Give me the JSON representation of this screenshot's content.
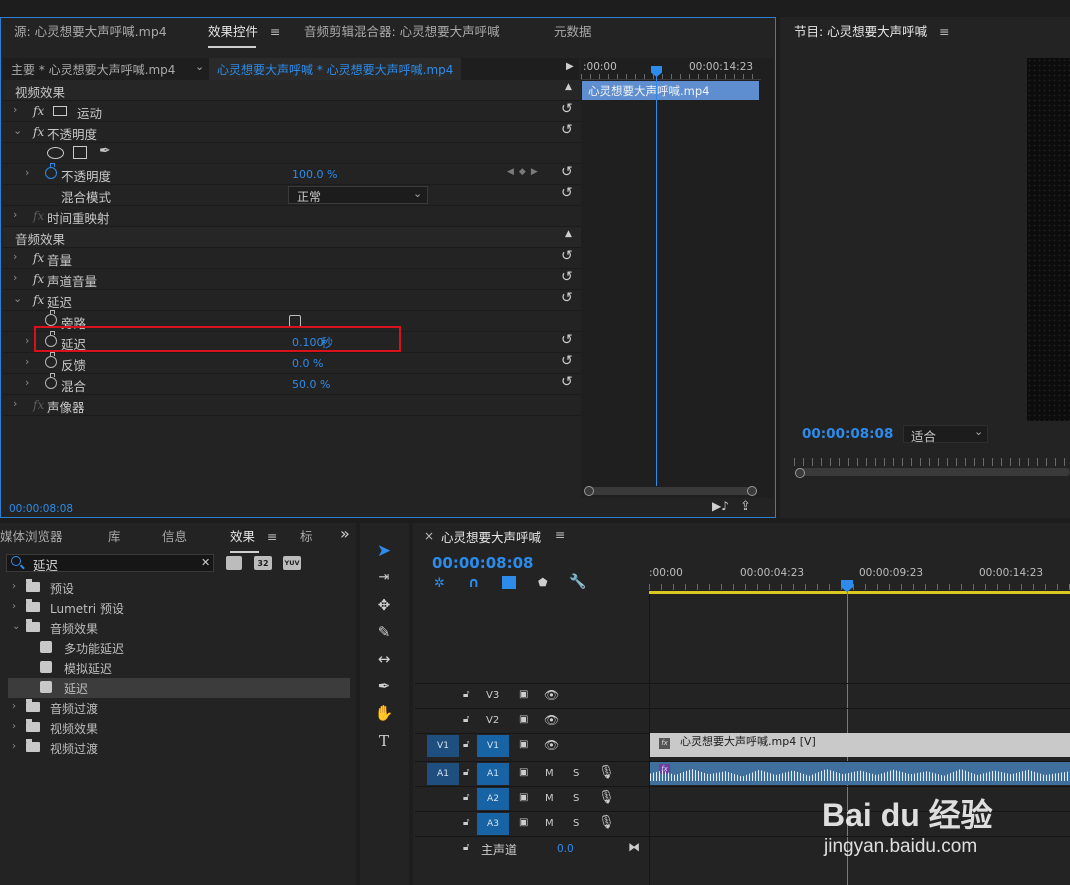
{
  "source_panel": {
    "tabs": [
      "源: 心灵想要大声呼喊.mp4",
      "效果控件",
      "音频剪辑混合器: 心灵想要大声呼喊",
      "元数据"
    ],
    "menu_glyph": "≡",
    "master_clip": "主要 * 心灵想要大声呼喊.mp4",
    "sequence_clip": "心灵想要大声呼喊 * 心灵想要大声呼喊.mp4",
    "ruler_start": ":00:00",
    "ruler_end": "00:00:14:23",
    "clip_bar": "心灵想要大声呼喊.mp4",
    "video_effects_label": "视频效果",
    "audio_effects_label": "音频效果",
    "effects": {
      "motion": "运动",
      "opacity": "不透明度",
      "opacity_param": "不透明度",
      "opacity_value": "100.0 %",
      "blend_mode_label": "混合模式",
      "blend_mode_value": "正常",
      "time_remap": "时间重映射",
      "volume": "音量",
      "channel_volume": "声道音量",
      "delay": "延迟",
      "bypass": "旁路",
      "delay_param": "延迟",
      "delay_value": "0.100",
      "delay_unit": "秒",
      "feedback": "反馈",
      "feedback_value": "0.0 %",
      "mix": "混合",
      "mix_value": "50.0 %",
      "panner": "声像器"
    },
    "timecode": "00:00:08:08",
    "fx_glyph": "fx",
    "reset_glyph": "↺"
  },
  "program_panel": {
    "title": "节目: 心灵想要大声呼喊",
    "menu_glyph": "≡",
    "timecode": "00:00:08:08",
    "fit_label": "适合"
  },
  "effects_panel": {
    "tabs": [
      "媒体浏览器",
      "库",
      "信息",
      "效果",
      "标"
    ],
    "more_glyph": "»",
    "menu_glyph": "≡",
    "search_value": "延迟",
    "close_glyph": "✕",
    "badges": [
      "32",
      "YUV"
    ],
    "tree": [
      {
        "label": "预设",
        "kind": "folder-star",
        "indent": 0,
        "expanded": false
      },
      {
        "label": "Lumetri 预设",
        "kind": "folder-star",
        "indent": 0,
        "expanded": false
      },
      {
        "label": "音频效果",
        "kind": "folder",
        "indent": 0,
        "expanded": true
      },
      {
        "label": "多功能延迟",
        "kind": "effect",
        "indent": 1
      },
      {
        "label": "模拟延迟",
        "kind": "effect",
        "indent": 1
      },
      {
        "label": "延迟",
        "kind": "effect",
        "indent": 1,
        "selected": true
      },
      {
        "label": "音频过渡",
        "kind": "folder",
        "indent": 0,
        "expanded": false
      },
      {
        "label": "视频效果",
        "kind": "folder",
        "indent": 0,
        "expanded": false
      },
      {
        "label": "视频过渡",
        "kind": "folder",
        "indent": 0,
        "expanded": false
      }
    ]
  },
  "timeline": {
    "close_glyph": "×",
    "title": "心灵想要大声呼喊",
    "menu_glyph": "≡",
    "timecode": "00:00:08:08",
    "ruler": [
      ":00:00",
      "00:00:04:23",
      "00:00:09:23",
      "00:00:14:23"
    ],
    "tracks": {
      "v3": "V3",
      "v2": "V2",
      "v1_src": "V1",
      "v1": "V1",
      "a1_src": "A1",
      "a1": "A1",
      "a2": "A2",
      "a3": "A3",
      "mute": "M",
      "solo": "S",
      "master": "主声道",
      "master_value": "0.0"
    },
    "video_clip": "心灵想要大声呼喊.mp4 [V]",
    "fx_badge": "fx"
  },
  "watermark": {
    "logo_text": "Bai du 经验",
    "url": "jingyan.baidu.com"
  }
}
